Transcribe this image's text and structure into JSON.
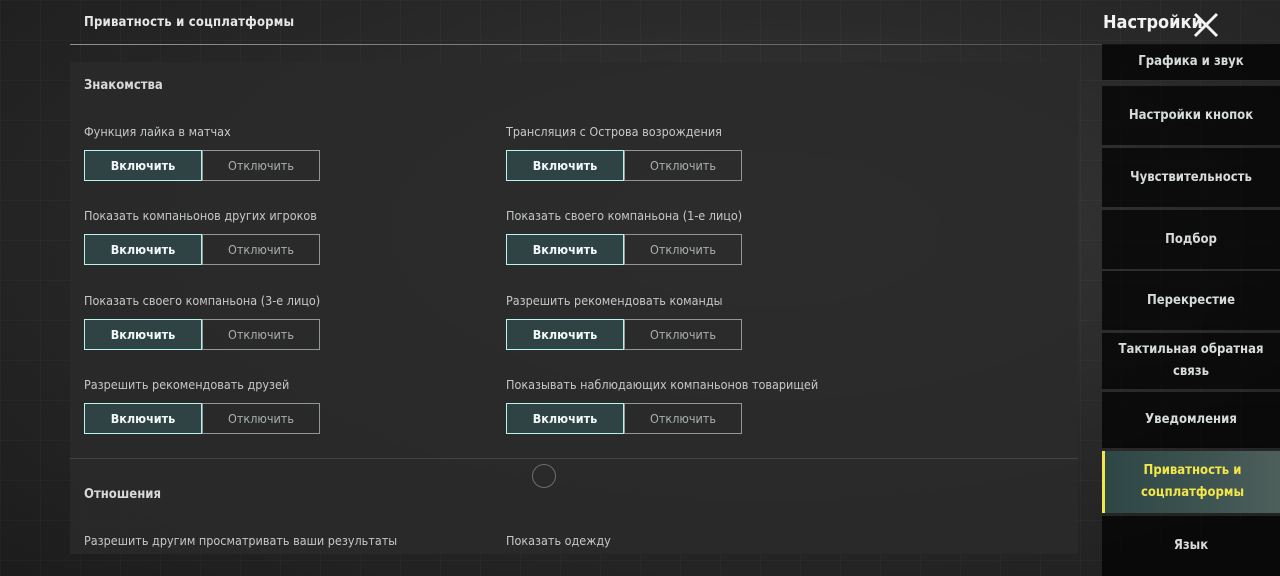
{
  "header": {
    "breadcrumb": "Приватность и соцплатформы",
    "settings_title": "Настройки"
  },
  "sections": {
    "dating": {
      "title": "Знакомства",
      "settings": [
        {
          "label": "Функция лайка в матчах",
          "on": "Включить",
          "off": "Отключить",
          "value": "on"
        },
        {
          "label": "Трансляция с Острова возрождения",
          "on": "Включить",
          "off": "Отключить",
          "value": "on"
        },
        {
          "label": "Показать компаньонов других игроков",
          "on": "Включить",
          "off": "Отключить",
          "value": "on"
        },
        {
          "label": "Показать своего компаньона (1-е лицо)",
          "on": "Включить",
          "off": "Отключить",
          "value": "on"
        },
        {
          "label": "Показать своего компаньона (3-е лицо)",
          "on": "Включить",
          "off": "Отключить",
          "value": "on"
        },
        {
          "label": "Разрешить рекомендовать команды",
          "on": "Включить",
          "off": "Отключить",
          "value": "on"
        },
        {
          "label": "Разрешить рекомендовать друзей",
          "on": "Включить",
          "off": "Отключить",
          "value": "on"
        },
        {
          "label": "Показывать наблюдающих компаньонов товарищей",
          "on": "Включить",
          "off": "Отключить",
          "value": "on"
        }
      ]
    },
    "relations": {
      "title": "Отношения",
      "settings": [
        {
          "label": "Разрешить другим просматривать ваши результаты"
        },
        {
          "label": "Показать одежду"
        }
      ]
    }
  },
  "sidebar": {
    "items": [
      {
        "label": "Графика и звук"
      },
      {
        "label": "Настройки кнопок"
      },
      {
        "label": "Чувствительность"
      },
      {
        "label": "Подбор"
      },
      {
        "label": "Перекрестие"
      },
      {
        "label": "Тактильная обратная связь"
      },
      {
        "label": "Уведомления"
      },
      {
        "label": "Приватность и соцплатформы",
        "active": true
      },
      {
        "label": "Язык"
      }
    ]
  },
  "colors": {
    "active_accent": "#f3e64b",
    "toggle_on_border": "#b9f3ee"
  },
  "icons": {
    "close": "close-icon"
  }
}
